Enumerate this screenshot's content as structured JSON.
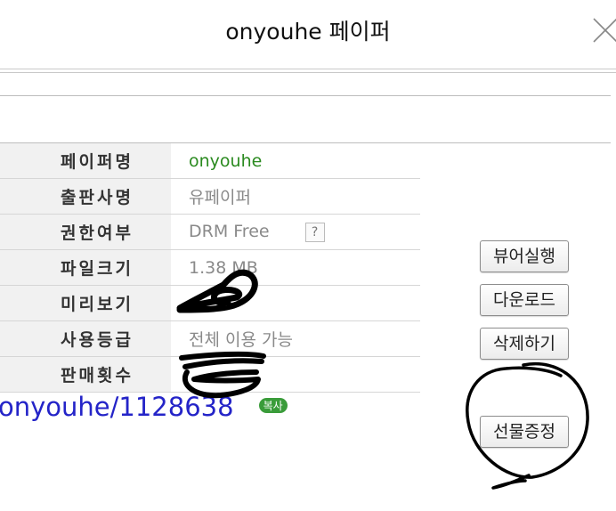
{
  "window": {
    "title": "onyouhe 페이퍼"
  },
  "info_rows": [
    {
      "label": "페이퍼명",
      "value": "onyouhe"
    },
    {
      "label": "출판사명",
      "value": "유페이퍼"
    },
    {
      "label": "권한여부",
      "value": "DRM Free",
      "help": "?"
    },
    {
      "label": "파일크기",
      "value": "1.38 MB"
    },
    {
      "label": "미리보기",
      "value": ""
    },
    {
      "label": "사용등급",
      "value": "전체 이용 가능"
    },
    {
      "label": "판매횟수",
      "value": ""
    }
  ],
  "url": {
    "text": "onyouhe/1128638",
    "copy_label": "복사"
  },
  "buttons": {
    "viewer": "뷰어실행",
    "download": "다운로드",
    "delete": "삭제하기",
    "gift": "선물증정"
  }
}
